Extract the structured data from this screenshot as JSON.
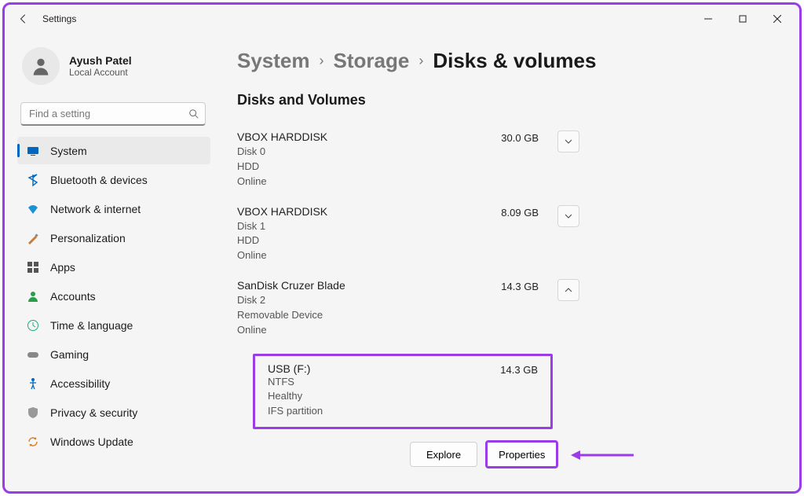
{
  "window": {
    "title": "Settings"
  },
  "user": {
    "name": "Ayush Patel",
    "sub": "Local Account"
  },
  "search": {
    "placeholder": "Find a setting"
  },
  "nav": {
    "items": [
      {
        "label": "System",
        "icon": "system",
        "active": true
      },
      {
        "label": "Bluetooth & devices",
        "icon": "bluetooth"
      },
      {
        "label": "Network & internet",
        "icon": "network"
      },
      {
        "label": "Personalization",
        "icon": "personalization"
      },
      {
        "label": "Apps",
        "icon": "apps"
      },
      {
        "label": "Accounts",
        "icon": "accounts"
      },
      {
        "label": "Time & language",
        "icon": "time"
      },
      {
        "label": "Gaming",
        "icon": "gaming"
      },
      {
        "label": "Accessibility",
        "icon": "accessibility"
      },
      {
        "label": "Privacy & security",
        "icon": "privacy"
      },
      {
        "label": "Windows Update",
        "icon": "update"
      }
    ]
  },
  "breadcrumb": {
    "a": "System",
    "b": "Storage",
    "c": "Disks & volumes"
  },
  "section_title": "Disks and Volumes",
  "disks": [
    {
      "name": "VBOX HARDDISK",
      "l1": "Disk 0",
      "l2": "HDD",
      "l3": "Online",
      "size": "30.0 GB",
      "expanded": false
    },
    {
      "name": "VBOX HARDDISK",
      "l1": "Disk 1",
      "l2": "HDD",
      "l3": "Online",
      "size": "8.09 GB",
      "expanded": false
    },
    {
      "name": "SanDisk Cruzer Blade",
      "l1": "Disk 2",
      "l2": "Removable Device",
      "l3": "Online",
      "size": "14.3 GB",
      "expanded": true
    }
  ],
  "volume": {
    "name": "USB (F:)",
    "l1": "NTFS",
    "l2": "Healthy",
    "l3": "IFS partition",
    "size": "14.3 GB"
  },
  "buttons": {
    "explore": "Explore",
    "properties": "Properties"
  },
  "colors": {
    "accent": "#0067c0",
    "highlight": "#9b3ce8"
  }
}
